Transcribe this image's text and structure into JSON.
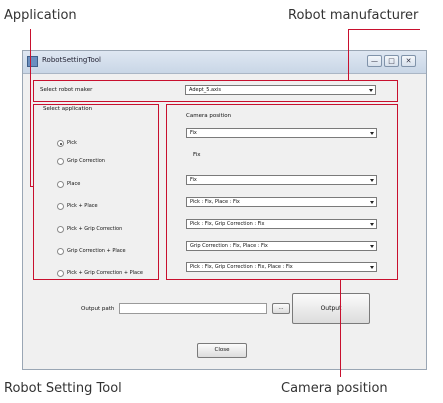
{
  "callouts": {
    "application": "Application",
    "robot_manufacturer": "Robot manufacturer",
    "robot_setting_tool": "Robot Setting Tool",
    "camera_position": "Camera position"
  },
  "window": {
    "title": "RobotSettingTool",
    "controls": [
      "—",
      "□",
      "✕"
    ]
  },
  "robot_maker": {
    "label": "Select robot maker",
    "value": "Adept_5.axis"
  },
  "application": {
    "label": "Select application",
    "options": [
      "Pick",
      "Grip Correction",
      "Place",
      "Pick + Place",
      "Pick + Grip Correction",
      "Grip Correction + Place",
      "Pick + Grip Correction + Place"
    ],
    "selected_index": 0
  },
  "camera": {
    "label": "Camera position",
    "fields": [
      {
        "type": "combo",
        "value": "Fix"
      },
      {
        "type": "text",
        "value": "Fix"
      },
      {
        "type": "combo",
        "value": "Fix"
      },
      {
        "type": "combo",
        "value": "Pick : Fix, Place : Fix"
      },
      {
        "type": "combo",
        "value": "Pick : Fix, Grip Correction : Fix"
      },
      {
        "type": "combo",
        "value": "Grip Correction : Fix, Place : Fix"
      },
      {
        "type": "combo",
        "value": "Pick : Fix, Grip Correction : Fix, Place : Fix"
      }
    ]
  },
  "output": {
    "path_label": "Output path",
    "browse_label": "...",
    "button_label": "Output"
  },
  "close_label": "Close",
  "colors": {
    "annotation": "#c8102e"
  }
}
